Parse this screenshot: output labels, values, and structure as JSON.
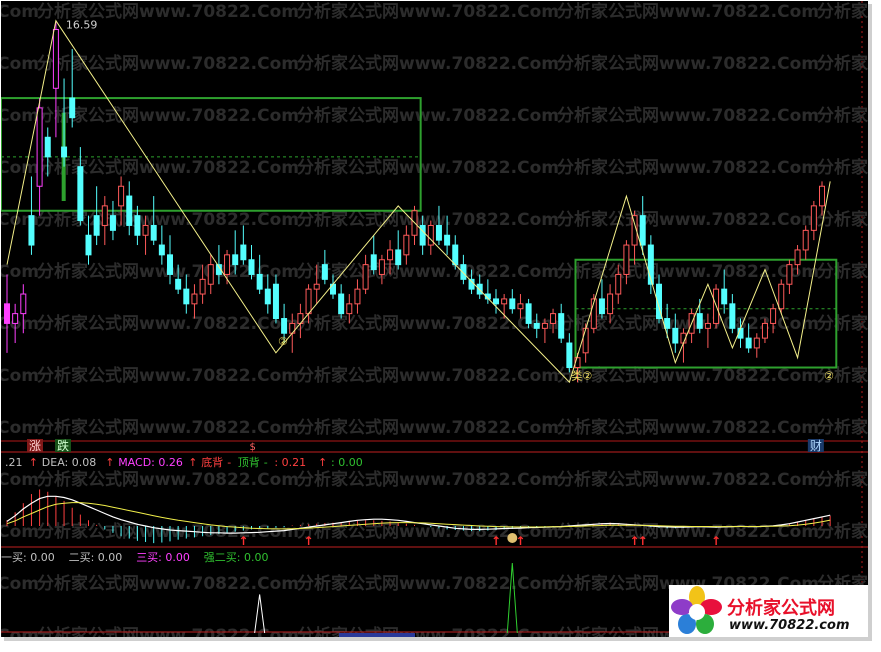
{
  "watermark": "分析家公式网www.70822.Com",
  "chart_data": [
    {
      "type": "candlestick",
      "id": "price",
      "high_label": "16.59",
      "candles": [
        {
          "o": 13.7,
          "h": 14.0,
          "l": 13.2,
          "c": 13.5
        },
        {
          "o": 13.5,
          "h": 13.7,
          "l": 13.3,
          "c": 13.6
        },
        {
          "o": 13.6,
          "h": 13.9,
          "l": 13.4,
          "c": 13.8
        },
        {
          "o": 14.6,
          "h": 15.0,
          "l": 14.2,
          "c": 14.3
        },
        {
          "o": 14.9,
          "h": 15.8,
          "l": 14.6,
          "c": 15.7
        },
        {
          "o": 15.4,
          "h": 15.5,
          "l": 15.0,
          "c": 15.2
        },
        {
          "o": 15.9,
          "h": 16.59,
          "l": 15.4,
          "c": 16.5
        },
        {
          "o": 15.3,
          "h": 16.0,
          "l": 15.1,
          "c": 15.2
        },
        {
          "o": 15.8,
          "h": 16.3,
          "l": 15.5,
          "c": 15.6
        },
        {
          "o": 15.1,
          "h": 15.3,
          "l": 14.5,
          "c": 14.55
        },
        {
          "o": 14.4,
          "h": 14.6,
          "l": 14.1,
          "c": 14.2
        },
        {
          "o": 14.6,
          "h": 14.9,
          "l": 14.3,
          "c": 14.4
        },
        {
          "o": 14.5,
          "h": 14.8,
          "l": 14.3,
          "c": 14.7
        },
        {
          "o": 14.6,
          "h": 14.75,
          "l": 14.35,
          "c": 14.45
        },
        {
          "o": 14.7,
          "h": 15.0,
          "l": 14.5,
          "c": 14.9
        },
        {
          "o": 14.8,
          "h": 14.95,
          "l": 14.4,
          "c": 14.5
        },
        {
          "o": 14.6,
          "h": 14.7,
          "l": 14.3,
          "c": 14.4
        },
        {
          "o": 14.4,
          "h": 14.6,
          "l": 14.2,
          "c": 14.5
        },
        {
          "o": 14.5,
          "h": 14.8,
          "l": 14.3,
          "c": 14.35
        },
        {
          "o": 14.3,
          "h": 14.5,
          "l": 14.1,
          "c": 14.2
        },
        {
          "o": 14.2,
          "h": 14.4,
          "l": 13.9,
          "c": 14.0
        },
        {
          "o": 13.95,
          "h": 14.1,
          "l": 13.8,
          "c": 13.85
        },
        {
          "o": 13.85,
          "h": 14.0,
          "l": 13.6,
          "c": 13.7
        },
        {
          "o": 13.7,
          "h": 13.9,
          "l": 13.55,
          "c": 13.8
        },
        {
          "o": 13.8,
          "h": 14.1,
          "l": 13.7,
          "c": 13.95
        },
        {
          "o": 13.9,
          "h": 14.2,
          "l": 13.8,
          "c": 14.1
        },
        {
          "o": 14.1,
          "h": 14.3,
          "l": 13.9,
          "c": 14.0
        },
        {
          "o": 14.0,
          "h": 14.25,
          "l": 13.9,
          "c": 14.2
        },
        {
          "o": 14.2,
          "h": 14.45,
          "l": 14.0,
          "c": 14.1
        },
        {
          "o": 14.3,
          "h": 14.5,
          "l": 14.1,
          "c": 14.15
        },
        {
          "o": 14.15,
          "h": 14.3,
          "l": 13.95,
          "c": 14.0
        },
        {
          "o": 14.0,
          "h": 14.2,
          "l": 13.8,
          "c": 13.85
        },
        {
          "o": 13.85,
          "h": 14.0,
          "l": 13.6,
          "c": 13.7
        },
        {
          "o": 13.9,
          "h": 14.0,
          "l": 13.5,
          "c": 13.55
        },
        {
          "o": 13.55,
          "h": 13.7,
          "l": 13.3,
          "c": 13.4
        },
        {
          "o": 13.4,
          "h": 13.6,
          "l": 13.2,
          "c": 13.5
        },
        {
          "o": 13.5,
          "h": 13.7,
          "l": 13.35,
          "c": 13.6
        },
        {
          "o": 13.6,
          "h": 13.9,
          "l": 13.5,
          "c": 13.85
        },
        {
          "o": 13.85,
          "h": 14.1,
          "l": 13.7,
          "c": 13.9
        },
        {
          "o": 14.1,
          "h": 14.25,
          "l": 13.9,
          "c": 13.95
        },
        {
          "o": 13.9,
          "h": 14.0,
          "l": 13.75,
          "c": 13.8
        },
        {
          "o": 13.8,
          "h": 13.9,
          "l": 13.55,
          "c": 13.6
        },
        {
          "o": 13.6,
          "h": 13.8,
          "l": 13.5,
          "c": 13.7
        },
        {
          "o": 13.7,
          "h": 13.95,
          "l": 13.6,
          "c": 13.85
        },
        {
          "o": 13.85,
          "h": 14.2,
          "l": 13.8,
          "c": 14.1
        },
        {
          "o": 14.2,
          "h": 14.4,
          "l": 14.0,
          "c": 14.05
        },
        {
          "o": 14.0,
          "h": 14.2,
          "l": 13.9,
          "c": 14.15
        },
        {
          "o": 14.15,
          "h": 14.35,
          "l": 14.0,
          "c": 14.25
        },
        {
          "o": 14.25,
          "h": 14.45,
          "l": 14.05,
          "c": 14.1
        },
        {
          "o": 14.2,
          "h": 14.5,
          "l": 14.1,
          "c": 14.4
        },
        {
          "o": 14.4,
          "h": 14.7,
          "l": 14.3,
          "c": 14.65
        },
        {
          "o": 14.5,
          "h": 14.6,
          "l": 14.2,
          "c": 14.3
        },
        {
          "o": 14.3,
          "h": 14.55,
          "l": 14.2,
          "c": 14.5
        },
        {
          "o": 14.5,
          "h": 14.7,
          "l": 14.3,
          "c": 14.35
        },
        {
          "o": 14.4,
          "h": 14.6,
          "l": 14.2,
          "c": 14.3
        },
        {
          "o": 14.3,
          "h": 14.4,
          "l": 14.05,
          "c": 14.1
        },
        {
          "o": 14.1,
          "h": 14.2,
          "l": 13.9,
          "c": 13.95
        },
        {
          "o": 13.95,
          "h": 14.05,
          "l": 13.8,
          "c": 13.85
        },
        {
          "o": 13.9,
          "h": 14.0,
          "l": 13.75,
          "c": 13.8
        },
        {
          "o": 13.8,
          "h": 13.95,
          "l": 13.7,
          "c": 13.75
        },
        {
          "o": 13.75,
          "h": 13.85,
          "l": 13.6,
          "c": 13.7
        },
        {
          "o": 13.7,
          "h": 13.8,
          "l": 13.55,
          "c": 13.75
        },
        {
          "o": 13.75,
          "h": 13.85,
          "l": 13.6,
          "c": 13.65
        },
        {
          "o": 13.65,
          "h": 13.8,
          "l": 13.55,
          "c": 13.7
        },
        {
          "o": 13.7,
          "h": 13.75,
          "l": 13.45,
          "c": 13.5
        },
        {
          "o": 13.5,
          "h": 13.6,
          "l": 13.35,
          "c": 13.45
        },
        {
          "o": 13.45,
          "h": 13.55,
          "l": 13.3,
          "c": 13.5
        },
        {
          "o": 13.5,
          "h": 13.65,
          "l": 13.4,
          "c": 13.6
        },
        {
          "o": 13.6,
          "h": 13.7,
          "l": 13.3,
          "c": 13.35
        },
        {
          "o": 13.3,
          "h": 13.4,
          "l": 13.0,
          "c": 13.05
        },
        {
          "o": 13.05,
          "h": 13.2,
          "l": 12.9,
          "c": 13.15
        },
        {
          "o": 13.2,
          "h": 13.5,
          "l": 13.1,
          "c": 13.45
        },
        {
          "o": 13.45,
          "h": 13.8,
          "l": 13.4,
          "c": 13.75
        },
        {
          "o": 13.75,
          "h": 13.95,
          "l": 13.55,
          "c": 13.6
        },
        {
          "o": 13.6,
          "h": 13.9,
          "l": 13.5,
          "c": 13.8
        },
        {
          "o": 13.8,
          "h": 14.1,
          "l": 13.7,
          "c": 14.0
        },
        {
          "o": 14.0,
          "h": 14.35,
          "l": 13.9,
          "c": 14.3
        },
        {
          "o": 14.3,
          "h": 14.65,
          "l": 14.1,
          "c": 14.6
        },
        {
          "o": 14.6,
          "h": 14.8,
          "l": 14.2,
          "c": 14.3
        },
        {
          "o": 14.3,
          "h": 14.4,
          "l": 13.8,
          "c": 13.9
        },
        {
          "o": 13.9,
          "h": 14.0,
          "l": 13.5,
          "c": 13.55
        },
        {
          "o": 13.55,
          "h": 13.7,
          "l": 13.35,
          "c": 13.45
        },
        {
          "o": 13.45,
          "h": 13.6,
          "l": 13.2,
          "c": 13.3
        },
        {
          "o": 13.3,
          "h": 13.45,
          "l": 13.1,
          "c": 13.4
        },
        {
          "o": 13.4,
          "h": 13.65,
          "l": 13.3,
          "c": 13.6
        },
        {
          "o": 13.6,
          "h": 13.75,
          "l": 13.4,
          "c": 13.45
        },
        {
          "o": 13.45,
          "h": 13.6,
          "l": 13.25,
          "c": 13.5
        },
        {
          "o": 13.5,
          "h": 13.9,
          "l": 13.45,
          "c": 13.85
        },
        {
          "o": 13.85,
          "h": 14.05,
          "l": 13.6,
          "c": 13.7
        },
        {
          "o": 13.7,
          "h": 13.8,
          "l": 13.4,
          "c": 13.45
        },
        {
          "o": 13.45,
          "h": 13.55,
          "l": 13.25,
          "c": 13.35
        },
        {
          "o": 13.35,
          "h": 13.5,
          "l": 13.2,
          "c": 13.25
        },
        {
          "o": 13.25,
          "h": 13.4,
          "l": 13.15,
          "c": 13.35
        },
        {
          "o": 13.35,
          "h": 13.55,
          "l": 13.3,
          "c": 13.5
        },
        {
          "o": 13.5,
          "h": 13.7,
          "l": 13.4,
          "c": 13.65
        },
        {
          "o": 13.65,
          "h": 13.95,
          "l": 13.6,
          "c": 13.9
        },
        {
          "o": 13.9,
          "h": 14.15,
          "l": 13.8,
          "c": 14.1
        },
        {
          "o": 14.1,
          "h": 14.3,
          "l": 14.0,
          "c": 14.25
        },
        {
          "o": 14.25,
          "h": 14.5,
          "l": 14.15,
          "c": 14.45
        },
        {
          "o": 14.45,
          "h": 14.75,
          "l": 14.35,
          "c": 14.7
        },
        {
          "o": 14.7,
          "h": 14.95,
          "l": 14.6,
          "c": 14.9
        }
      ],
      "zigzag": [
        {
          "i": 0,
          "v": 14.1
        },
        {
          "i": 6,
          "v": 16.59
        },
        {
          "i": 33,
          "v": 13.2
        },
        {
          "i": 48,
          "v": 14.7
        },
        {
          "i": 69,
          "v": 12.9
        },
        {
          "i": 76,
          "v": 14.8
        },
        {
          "i": 82,
          "v": 13.1
        },
        {
          "i": 86,
          "v": 13.9
        },
        {
          "i": 89,
          "v": 13.25
        },
        {
          "i": 93,
          "v": 14.05
        },
        {
          "i": 97,
          "v": 13.15
        },
        {
          "i": 101,
          "v": 14.95
        }
      ],
      "boxes": [
        {
          "i0": -1,
          "i1": 51,
          "top": 15.8,
          "bottom": 14.65,
          "mid": 15.2
        },
        {
          "i0": 70,
          "i1": 102,
          "top": 14.15,
          "bottom": 13.05,
          "mid": 13.65
        }
      ],
      "markers": [
        {
          "i": 33,
          "v": 13.4,
          "label": "②"
        },
        {
          "i": 69,
          "v": 13.05,
          "label": "类②"
        },
        {
          "i": 100,
          "v": 13.05,
          "label": "②"
        }
      ],
      "ylim": [
        12.3,
        16.75
      ],
      "legend_labels": [
        "涨",
        "跌"
      ],
      "event_labels": [
        {
          "i": 30,
          "label": "$"
        },
        {
          "i": 99,
          "label": "财"
        }
      ]
    },
    {
      "type": "histogram+line",
      "id": "macd",
      "header": [
        {
          "text": ".21",
          "color": "#c0c0c0"
        },
        {
          "text": "↑",
          "color": "#ff4040"
        },
        {
          "text": "DEA: 0.08",
          "color": "#c0c0c0"
        },
        {
          "text": "↑",
          "color": "#ff4040"
        },
        {
          "text": "MACD: 0.26",
          "color": "#ff40ff"
        },
        {
          "text": "↑",
          "color": "#ff4040"
        },
        {
          "text": "底背",
          "color": "#ff4040"
        },
        {
          "text": "-",
          "color": "#ff4040"
        },
        {
          "text": "顶背",
          "color": "#30c030"
        },
        {
          "text": "-",
          "color": "#30c030"
        },
        {
          "text": ": 0.21",
          "color": "#ff4040"
        },
        {
          "text": "↑",
          "color": "#ff4040"
        },
        {
          "text": ": 0.00",
          "color": "#30c030"
        }
      ],
      "bars": [
        0.5,
        1.2,
        2.0,
        2.8,
        3.2,
        3.0,
        2.6,
        2.2,
        1.6,
        1.0,
        0.5,
        0.1,
        -0.3,
        -0.6,
        -0.9,
        -1.1,
        -1.3,
        -1.4,
        -1.5,
        -1.45,
        -1.35,
        -1.2,
        -1.1,
        -1.0,
        -0.9,
        -0.8,
        -0.7,
        -0.6,
        -0.5,
        -0.4,
        -0.3,
        -0.25,
        -0.2,
        -0.15,
        -0.1,
        0.05,
        0.1,
        0.15,
        0.2,
        0.25,
        0.3,
        0.35,
        0.4,
        0.45,
        0.5,
        0.5,
        0.45,
        0.4,
        0.3,
        0.2,
        0.1,
        0.0,
        -0.1,
        -0.2,
        -0.3,
        -0.35,
        -0.4,
        -0.45,
        -0.45,
        -0.4,
        -0.35,
        -0.3,
        -0.25,
        -0.2,
        -0.2,
        -0.15,
        -0.1,
        -0.1,
        -0.05,
        0.05,
        0.1,
        0.15,
        0.2,
        0.25,
        0.3,
        0.25,
        0.2,
        0.1,
        0.0,
        -0.1,
        -0.15,
        -0.2,
        -0.2,
        -0.15,
        -0.1,
        -0.05,
        -0.1,
        -0.15,
        -0.1,
        -0.05,
        0.0,
        -0.05,
        -0.1,
        -0.05,
        0.05,
        0.1,
        0.2,
        0.35,
        0.5,
        0.65,
        0.8,
        0.9
      ],
      "diff": [
        0.4,
        0.9,
        1.5,
        2.0,
        2.4,
        2.6,
        2.6,
        2.5,
        2.3,
        2.0,
        1.7,
        1.4,
        1.1,
        0.8,
        0.55,
        0.35,
        0.15,
        0.0,
        -0.15,
        -0.25,
        -0.35,
        -0.4,
        -0.45,
        -0.5,
        -0.55,
        -0.6,
        -0.6,
        -0.62,
        -0.62,
        -0.6,
        -0.58,
        -0.55,
        -0.5,
        -0.45,
        -0.4,
        -0.3,
        -0.2,
        -0.1,
        0.0,
        0.1,
        0.2,
        0.3,
        0.4,
        0.5,
        0.55,
        0.6,
        0.6,
        0.55,
        0.5,
        0.4,
        0.3,
        0.2,
        0.1,
        0.0,
        -0.1,
        -0.2,
        -0.25,
        -0.3,
        -0.3,
        -0.28,
        -0.25,
        -0.22,
        -0.2,
        -0.18,
        -0.15,
        -0.12,
        -0.1,
        -0.08,
        -0.05,
        0.0,
        0.05,
        0.1,
        0.15,
        0.2,
        0.22,
        0.2,
        0.15,
        0.1,
        0.05,
        0.0,
        -0.05,
        -0.08,
        -0.1,
        -0.1,
        -0.08,
        -0.06,
        -0.08,
        -0.1,
        -0.08,
        -0.05,
        -0.03,
        -0.05,
        -0.06,
        -0.03,
        0.02,
        0.1,
        0.2,
        0.35,
        0.5,
        0.65,
        0.8,
        0.95
      ],
      "dea": [
        0.2,
        0.45,
        0.8,
        1.1,
        1.4,
        1.7,
        1.9,
        2.0,
        2.05,
        2.05,
        2.0,
        1.9,
        1.8,
        1.65,
        1.5,
        1.35,
        1.2,
        1.05,
        0.9,
        0.75,
        0.62,
        0.5,
        0.4,
        0.3,
        0.2,
        0.1,
        0.02,
        -0.05,
        -0.1,
        -0.15,
        -0.2,
        -0.22,
        -0.24,
        -0.25,
        -0.25,
        -0.24,
        -0.22,
        -0.18,
        -0.14,
        -0.1,
        -0.05,
        0.0,
        0.05,
        0.1,
        0.15,
        0.2,
        0.25,
        0.28,
        0.3,
        0.3,
        0.29,
        0.27,
        0.24,
        0.2,
        0.16,
        0.12,
        0.08,
        0.04,
        0.0,
        -0.03,
        -0.05,
        -0.07,
        -0.08,
        -0.09,
        -0.09,
        -0.09,
        -0.08,
        -0.07,
        -0.06,
        -0.04,
        -0.02,
        0.0,
        0.02,
        0.04,
        0.06,
        0.07,
        0.07,
        0.06,
        0.05,
        0.04,
        0.02,
        0.0,
        -0.02,
        -0.03,
        -0.04,
        -0.04,
        -0.04,
        -0.05,
        -0.05,
        -0.05,
        -0.04,
        -0.04,
        -0.04,
        -0.03,
        -0.02,
        0.0,
        0.03,
        0.08,
        0.15,
        0.25,
        0.38,
        0.52
      ],
      "ylim": [
        -2.2,
        4.2
      ],
      "buy_arrows": [
        29,
        37,
        60,
        63,
        77,
        78,
        87
      ],
      "icon_at": 62
    },
    {
      "type": "line",
      "id": "signals",
      "header": [
        {
          "text": "一买: 0.00",
          "color": "#c0c0c0"
        },
        {
          "text": "二买: 0.00",
          "color": "#c0c0c0"
        },
        {
          "text": "三买: 0.00",
          "color": "#ff40ff"
        },
        {
          "text": "强二买: 0.00",
          "color": "#30c030"
        }
      ],
      "spikes": [
        {
          "i": 31,
          "h": 0.55,
          "color": "#ffffff"
        },
        {
          "i": 62,
          "h": 1.0,
          "color": "#30d030"
        }
      ]
    }
  ],
  "logo": {
    "title": "分析家公式网",
    "url": "www.70822.com"
  }
}
